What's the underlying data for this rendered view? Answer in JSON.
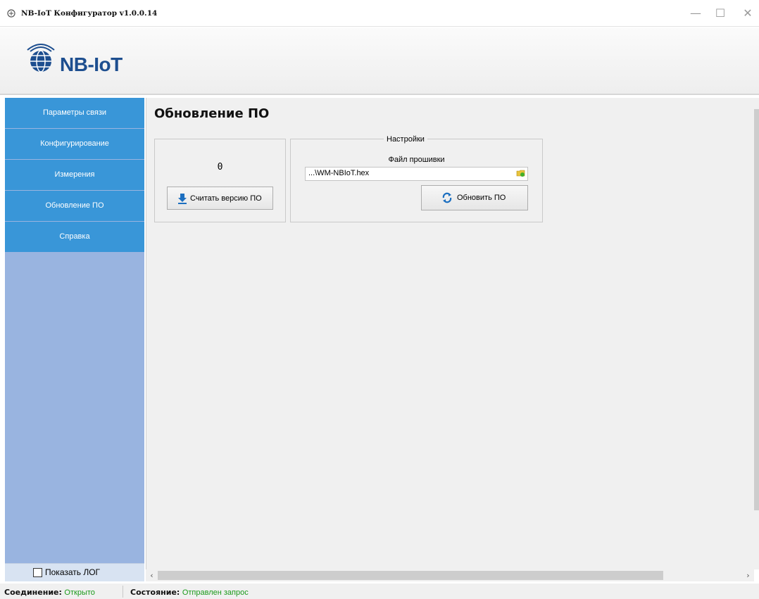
{
  "window": {
    "title": "NB-IoT Конфигуратор v1.0.0.14",
    "minimize_glyph": "—",
    "maximize_glyph": "☐",
    "close_glyph": "✕"
  },
  "logo": {
    "text": "NB-IoT",
    "color": "#1d4e8f"
  },
  "sidebar": {
    "items": [
      {
        "label": "Параметры связи"
      },
      {
        "label": "Конфигурирование"
      },
      {
        "label": "Измерения"
      },
      {
        "label": "Обновление ПО"
      },
      {
        "label": "Справка"
      }
    ],
    "active_index": 3,
    "show_log_label": "Показать ЛОГ",
    "show_log_checked": false
  },
  "main": {
    "title": "Обновление ПО",
    "version_value": "0",
    "read_version_button": "Считать версию ПО",
    "settings": {
      "legend": "Настройки",
      "firmware_label": "Файл прошивки",
      "firmware_path": "...\\WM-NBIoT.hex",
      "update_button": "Обновить ПО"
    }
  },
  "statusbar": {
    "connection_label": "Соединение:",
    "connection_value": "Открыто",
    "state_label": "Состояние:",
    "state_value": "Отправлен запрос"
  },
  "colors": {
    "nav_item": "#3996d8",
    "sidebar_bg": "#99b4e0",
    "status_ok": "#1a9a1a"
  }
}
